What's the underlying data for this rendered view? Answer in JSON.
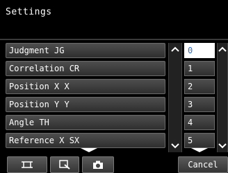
{
  "window": {
    "title": "Settings"
  },
  "items": [
    {
      "label": "Judgment JG"
    },
    {
      "label": "Correlation CR"
    },
    {
      "label": "Position X X"
    },
    {
      "label": "Position Y Y"
    },
    {
      "label": "Angle TH"
    },
    {
      "label": "Reference X SX"
    }
  ],
  "numbers": [
    {
      "label": "0",
      "selected": true
    },
    {
      "label": "1"
    },
    {
      "label": "2"
    },
    {
      "label": "3"
    },
    {
      "label": "4"
    },
    {
      "label": "5"
    }
  ],
  "toolbar": {
    "cancel_label": "Cancel",
    "icons": [
      "frame-icon",
      "zoom-icon",
      "camera-icon"
    ]
  }
}
